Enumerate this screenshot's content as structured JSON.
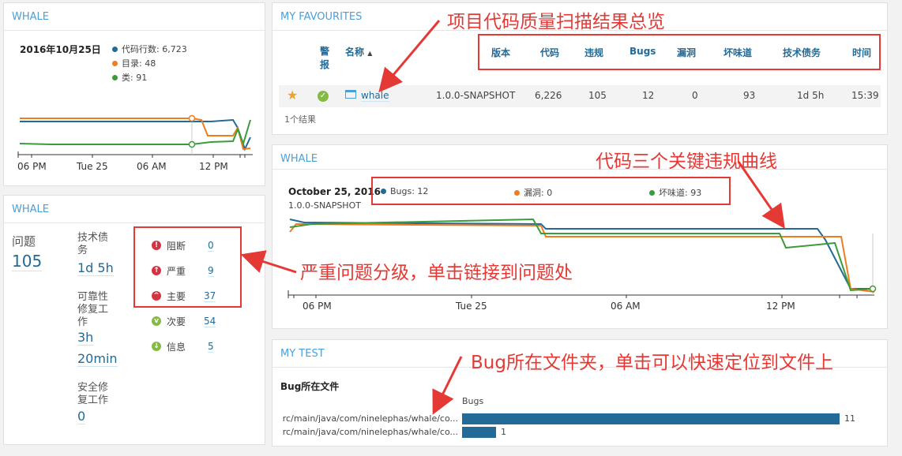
{
  "w1": {
    "title": "WHALE",
    "date": "2016年10月25日",
    "legend": [
      {
        "label": "代码行数: 6,723",
        "color": "#236a97"
      },
      {
        "label": "目录: 48",
        "color": "#ed7d20"
      },
      {
        "label": "类: 91",
        "color": "#3a9c3a"
      }
    ],
    "ticks": [
      "06 PM",
      "Tue 25",
      "06 AM",
      "12 PM"
    ]
  },
  "w2": {
    "title": "WHALE",
    "issues_label": "问题",
    "issues_value": "105",
    "debt_label": "技术债务",
    "debt_value": "1d 5h",
    "reliability_label": "可靠性修复工作",
    "reliability_value_1": "3h",
    "reliability_value_2": "20min",
    "security_label": "安全修复工作",
    "security_value": "0",
    "severities": [
      {
        "label": "阻断",
        "count": "0",
        "color": "#d4333f",
        "icon": "exclamation-circle-icon"
      },
      {
        "label": "严重",
        "count": "9",
        "color": "#d4333f",
        "icon": "arrow-up-circle-icon"
      },
      {
        "label": "主要",
        "count": "37",
        "color": "#d4333f",
        "icon": "chevron-up-circle-icon"
      },
      {
        "label": "次要",
        "count": "54",
        "color": "#85bb43",
        "icon": "chevron-down-circle-icon"
      },
      {
        "label": "信息",
        "count": "5",
        "color": "#85bb43",
        "icon": "arrow-down-circle-icon"
      }
    ]
  },
  "fav": {
    "title": "MY FAVOURITES",
    "col_alert": "警报",
    "col_name": "名称",
    "cols": [
      "版本",
      "代码",
      "违规",
      "Bugs",
      "漏洞",
      "坏味道",
      "技术债务",
      "时间"
    ],
    "row": {
      "name": "whale",
      "values": [
        "1.0.0-SNAPSHOT",
        "6,226",
        "105",
        "12",
        "0",
        "93",
        "1d 5h",
        "15:39"
      ]
    },
    "result_count": "1个结果"
  },
  "w3": {
    "title": "WHALE",
    "date": "October 25, 2016",
    "version": "1.0.0-SNAPSHOT",
    "legend": [
      {
        "label": "Bugs: 12",
        "color": "#236a97"
      },
      {
        "label": "漏洞: 0",
        "color": "#ed7d20"
      },
      {
        "label": "坏味道: 93",
        "color": "#3a9c3a"
      }
    ],
    "ticks": [
      "06 PM",
      "Tue 25",
      "06 AM",
      "12 PM"
    ]
  },
  "test": {
    "title": "MY TEST",
    "subtitle": "Bug所在文件",
    "col": "Bugs",
    "rows": [
      {
        "file": "rc/main/java/com/ninelephas/whale/co...",
        "value": "11"
      },
      {
        "file": "rc/main/java/com/ninelephas/whale/co...",
        "value": "1"
      }
    ]
  },
  "annotations": {
    "a1": "项目代码质量扫描结果总览",
    "a2": "代码三个关键违规曲线",
    "a3": "严重问题分级，单击链接到问题处",
    "a4": "Bug所在文件夹，单击可以快速定位到文件上"
  },
  "chart_data": [
    {
      "type": "line",
      "categories": [
        "06 PM",
        "Tue 25",
        "06 AM",
        "12 PM"
      ],
      "series": [
        {
          "name": "代码行数: 6,723",
          "color": "#236a97"
        },
        {
          "name": "目录: 48",
          "color": "#ed7d20"
        },
        {
          "name": "类: 91",
          "color": "#3a9c3a"
        }
      ]
    },
    {
      "type": "line",
      "categories": [
        "06 PM",
        "Tue 25",
        "06 AM",
        "12 PM"
      ],
      "series": [
        {
          "name": "Bugs: 12",
          "color": "#236a97"
        },
        {
          "name": "漏洞: 0",
          "color": "#ed7d20"
        },
        {
          "name": "坏味道: 93",
          "color": "#3a9c3a"
        }
      ]
    },
    {
      "type": "bar",
      "categories": [
        "rc/main/java/com/ninelephas/whale/co...",
        "rc/main/java/com/ninelephas/whale/co..."
      ],
      "values": [
        11,
        1
      ],
      "xlabel": "Bugs"
    }
  ]
}
